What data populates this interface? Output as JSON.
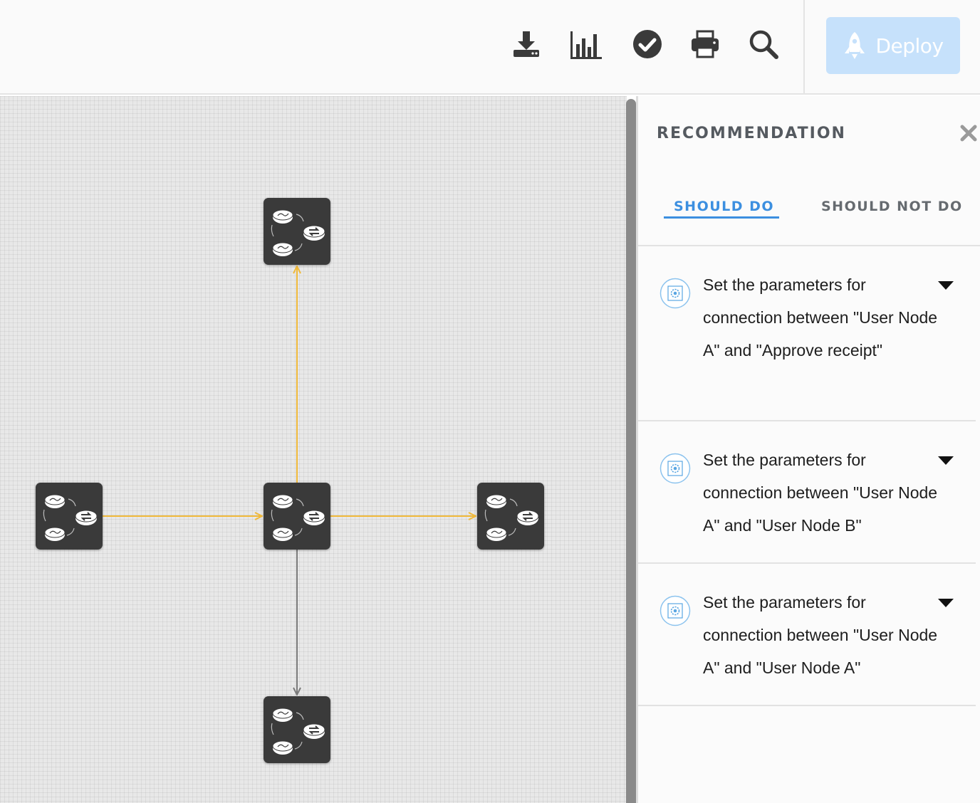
{
  "toolbar": {
    "icons": [
      "download-icon",
      "bar-chart-icon",
      "check-circle-icon",
      "print-icon",
      "search-icon"
    ],
    "deploy_label": "Deploy",
    "deploy_icon": "rocket-icon",
    "deploy_color": "#c6e1fb"
  },
  "canvas": {
    "nodes": [
      "node-top",
      "node-left",
      "node-center",
      "node-right",
      "node-bottom"
    ],
    "node_icon": "flow-nodes-icon",
    "active_edge_color": "#f0b93a",
    "inactive_edge_color": "#7a7a7a"
  },
  "panel": {
    "title": "RECOMMENDATION",
    "close_icon": "close-icon",
    "tabs": [
      {
        "label": "SHOULD DO",
        "active": true
      },
      {
        "label": "SHOULD NOT DO",
        "active": false
      }
    ],
    "accent_color": "#3c8fe0",
    "items": [
      {
        "icon": "settings-gear-icon",
        "text": "Set the parameters for connection between \"User Node A\" and \"Approve receipt\""
      },
      {
        "icon": "settings-gear-icon",
        "text": "Set the parameters for connection between \"User Node A\" and \"User Node B\""
      },
      {
        "icon": "settings-gear-icon",
        "text": "Set the parameters for connection between \"User Node A\" and \"User Node A\""
      }
    ]
  }
}
